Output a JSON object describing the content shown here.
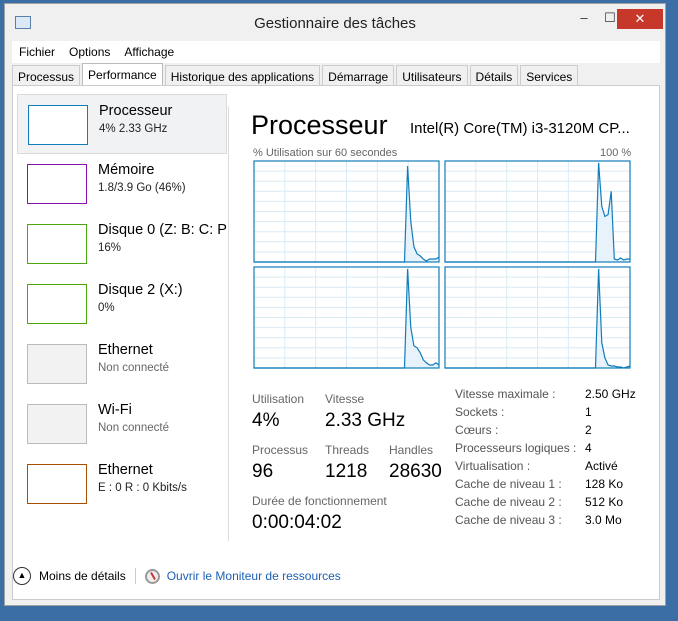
{
  "window": {
    "title": "Gestionnaire des tâches",
    "minimize": "–",
    "maximize": "☐",
    "close": "✕"
  },
  "menu": [
    "Fichier",
    "Options",
    "Affichage"
  ],
  "tabs": [
    "Processus",
    "Performance",
    "Historique des applications",
    "Démarrage",
    "Utilisateurs",
    "Détails",
    "Services"
  ],
  "active_tab": "Performance",
  "sidebar": [
    {
      "name": "Processeur",
      "sub": "4% 2.33 GHz",
      "color": "#117dbb"
    },
    {
      "name": "Mémoire",
      "sub": "1.8/3.9 Go (46%)",
      "color": "#8b12ae"
    },
    {
      "name": "Disque 0 (Z: B: C: P",
      "sub": "16%",
      "color": "#4da60c"
    },
    {
      "name": "Disque 2 (X:)",
      "sub": "0%",
      "color": "#4da60c"
    },
    {
      "name": "Ethernet",
      "sub": "Non connecté",
      "color": "#bbbbbb"
    },
    {
      "name": "Wi-Fi",
      "sub": "Non connecté",
      "color": "#bbbbbb"
    },
    {
      "name": "Ethernet",
      "sub": "E : 0 R : 0 Kbits/s",
      "color": "#a74f01"
    }
  ],
  "main": {
    "title": "Processeur",
    "model": "Intel(R) Core(TM) i3-3120M CP...",
    "caption_left": "% Utilisation sur 60 secondes",
    "caption_right": "100 %",
    "stats": {
      "utilisation_label": "Utilisation",
      "utilisation": "4%",
      "vitesse_label": "Vitesse",
      "vitesse": "2.33 GHz",
      "processus_label": "Processus",
      "processus": "96",
      "threads_label": "Threads",
      "threads": "1218",
      "handles_label": "Handles",
      "handles": "28630",
      "uptime_label": "Durée de fonctionnement",
      "uptime": "0:00:04:02"
    },
    "specs": [
      [
        "Vitesse maximale :",
        "2.50 GHz"
      ],
      [
        "Sockets :",
        "1"
      ],
      [
        "Cœurs :",
        "2"
      ],
      [
        "Processeurs logiques :",
        "4"
      ],
      [
        "Virtualisation :",
        "Activé"
      ],
      [
        "Cache de niveau 1 :",
        "128 Ko"
      ],
      [
        "Cache de niveau 2 :",
        "512 Ko"
      ],
      [
        "Cache de niveau 3 :",
        "3.0 Mo"
      ]
    ]
  },
  "footer": {
    "less": "Moins de détails",
    "monitor": "Ouvrir le Moniteur de ressources"
  },
  "chart_data": {
    "type": "area",
    "ylim": [
      0,
      100
    ],
    "x_seconds": 60,
    "grid": true,
    "color": "#117dbb",
    "series": [
      {
        "values": [
          0,
          0,
          0,
          0,
          0,
          0,
          0,
          0,
          0,
          0,
          0,
          0,
          0,
          0,
          0,
          0,
          0,
          0,
          0,
          0,
          0,
          0,
          0,
          0,
          0,
          0,
          0,
          0,
          0,
          0,
          0,
          0,
          0,
          0,
          0,
          0,
          0,
          0,
          0,
          0,
          0,
          0,
          0,
          0,
          0,
          0,
          0,
          0,
          0,
          95,
          40,
          15,
          8,
          6,
          3,
          1,
          3,
          3,
          3,
          5
        ]
      },
      {
        "values": [
          0,
          0,
          0,
          0,
          0,
          0,
          0,
          0,
          0,
          0,
          0,
          0,
          0,
          0,
          0,
          0,
          0,
          0,
          0,
          0,
          0,
          0,
          0,
          0,
          0,
          0,
          0,
          0,
          0,
          0,
          0,
          0,
          0,
          0,
          0,
          0,
          0,
          0,
          0,
          0,
          0,
          0,
          0,
          0,
          0,
          0,
          0,
          0,
          0,
          98,
          55,
          45,
          47,
          70,
          3,
          2,
          4,
          2,
          3,
          3
        ]
      },
      {
        "values": [
          0,
          0,
          0,
          0,
          0,
          0,
          0,
          0,
          0,
          0,
          0,
          0,
          0,
          0,
          0,
          0,
          0,
          0,
          0,
          0,
          0,
          0,
          0,
          0,
          0,
          0,
          0,
          0,
          0,
          0,
          0,
          0,
          0,
          0,
          0,
          0,
          0,
          0,
          0,
          0,
          0,
          0,
          0,
          0,
          0,
          0,
          0,
          0,
          0,
          98,
          40,
          22,
          20,
          15,
          8,
          5,
          3,
          3,
          5,
          3
        ]
      },
      {
        "values": [
          0,
          0,
          0,
          0,
          0,
          0,
          0,
          0,
          0,
          0,
          0,
          0,
          0,
          0,
          0,
          0,
          0,
          0,
          0,
          0,
          0,
          0,
          0,
          0,
          0,
          0,
          0,
          0,
          0,
          0,
          0,
          0,
          0,
          0,
          0,
          0,
          0,
          0,
          0,
          0,
          0,
          0,
          0,
          0,
          0,
          0,
          0,
          0,
          0,
          98,
          25,
          10,
          3,
          2,
          2,
          1,
          1,
          0,
          1,
          2
        ]
      }
    ]
  }
}
